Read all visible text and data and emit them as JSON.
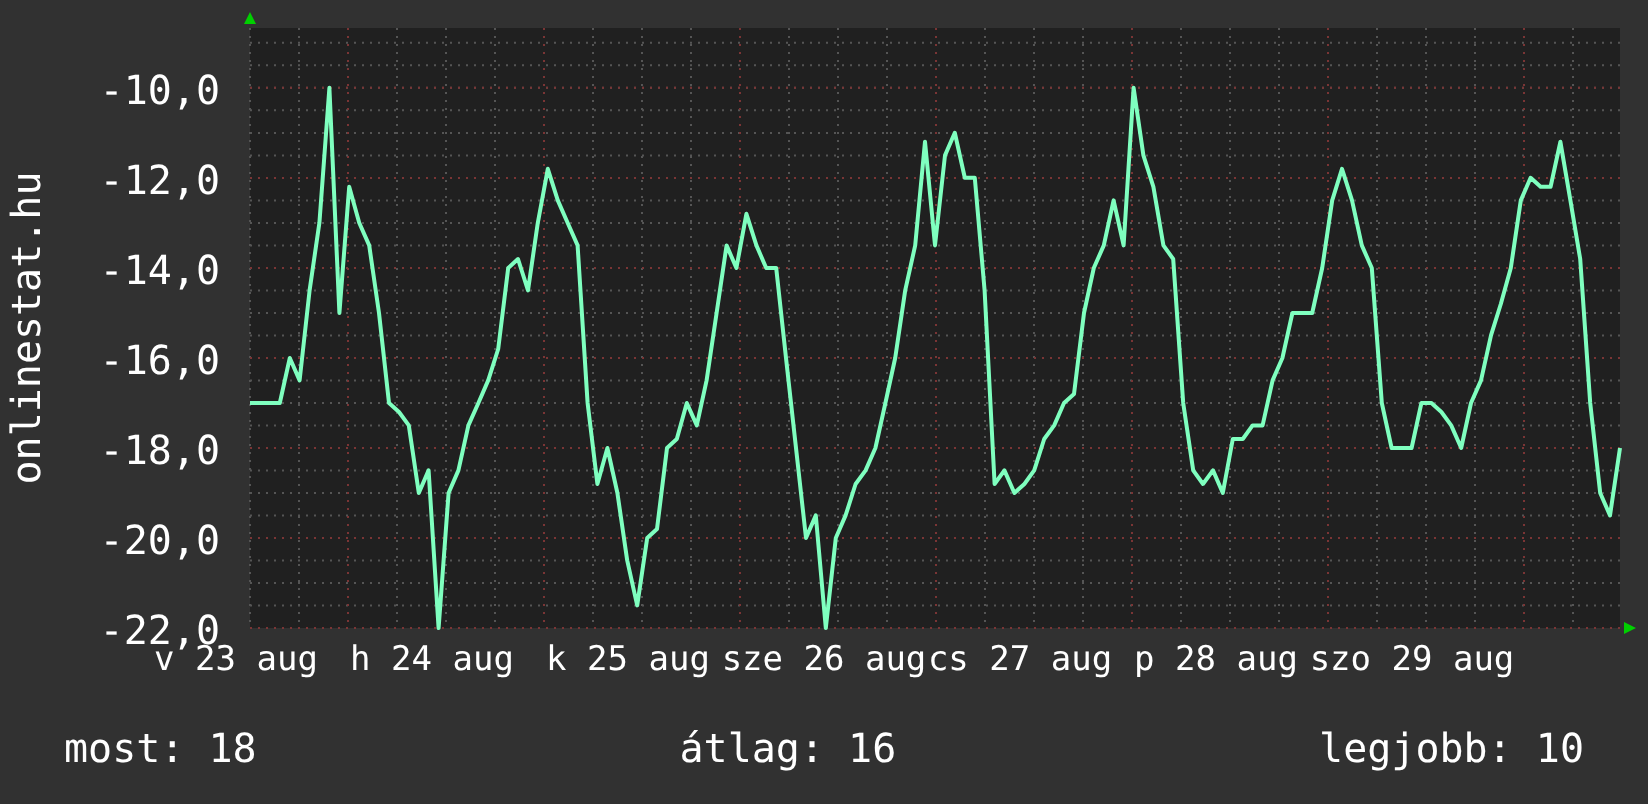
{
  "chart": {
    "x_axis_labels": [
      "v 23 aug",
      "h 24 aug",
      "k 25 aug",
      "sze 26 aug",
      "cs 27 aug",
      "p 28 aug",
      "szo 29 aug"
    ],
    "chart_data": {
      "type": "line",
      "ylabel": "onlinestat.hu",
      "ylim": [
        -22,
        -8.67
      ],
      "grid": true,
      "yticks": [
        {
          "value": -10,
          "label": "-10,0"
        },
        {
          "value": -12,
          "label": "-12,0"
        },
        {
          "value": -14,
          "label": "-14,0"
        },
        {
          "value": -16,
          "label": "-16,0"
        },
        {
          "value": -18,
          "label": "-18,0"
        },
        {
          "value": -20,
          "label": "-20,0"
        },
        {
          "value": -22,
          "label": "-22,0"
        }
      ],
      "series": [
        {
          "color": "#7fffbf",
          "values": [
            -17,
            -17,
            -17,
            -17,
            -16,
            -16.5,
            -14.5,
            -13,
            -10,
            -15,
            -12.2,
            -13,
            -13.5,
            -15,
            -17,
            -17.2,
            -17.5,
            -19,
            -18.5,
            -22,
            -19,
            -18.5,
            -17.5,
            -17,
            -16.5,
            -15.8,
            -14,
            -13.8,
            -14.5,
            -13,
            -11.8,
            -12.5,
            -13,
            -13.5,
            -17,
            -18.8,
            -18,
            -19,
            -20.5,
            -21.5,
            -20,
            -19.8,
            -18,
            -17.8,
            -17,
            -17.5,
            -16.5,
            -15,
            -13.5,
            -14,
            -12.8,
            -13.5,
            -14,
            -14,
            -16,
            -18,
            -20,
            -19.5,
            -22,
            -20,
            -19.5,
            -18.8,
            -18.5,
            -18,
            -17,
            -16,
            -14.5,
            -13.5,
            -11.2,
            -13.5,
            -11.5,
            -11,
            -12,
            -12,
            -14.5,
            -18.8,
            -18.5,
            -19,
            -18.8,
            -18.5,
            -17.8,
            -17.5,
            -17,
            -16.8,
            -15,
            -14,
            -13.5,
            -12.5,
            -13.5,
            -10,
            -11.5,
            -12.2,
            -13.5,
            -13.8,
            -17,
            -18.5,
            -18.8,
            -18.5,
            -19,
            -17.8,
            -17.8,
            -17.5,
            -17.5,
            -16.5,
            -16,
            -15,
            -15,
            -15,
            -14,
            -12.5,
            -11.8,
            -12.5,
            -13.5,
            -14,
            -17,
            -18,
            -18,
            -18,
            -17,
            -17,
            -17.2,
            -17.5,
            -18,
            -17,
            -16.5,
            -15.5,
            -14.8,
            -14,
            -12.5,
            -12,
            -12.2,
            -12.2,
            -11.2,
            -12.5,
            -13.8,
            -17,
            -19,
            -19.5,
            -18
          ]
        }
      ]
    }
  },
  "stats": [
    {
      "text": "most: 18"
    },
    {
      "text": "átlag: 16"
    },
    {
      "text": "legjobb: 10"
    }
  ]
}
